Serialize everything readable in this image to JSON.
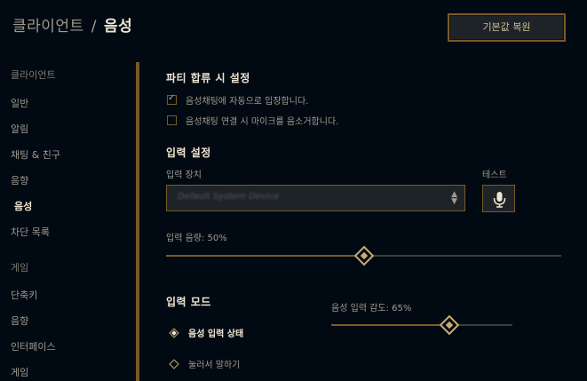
{
  "header": {
    "section": "클라이언트",
    "separator": "/",
    "current": "음성",
    "reset_label": "기본값 복원"
  },
  "sidebar": {
    "client_section": "클라이언트",
    "client_items": [
      {
        "label": "일반"
      },
      {
        "label": "알림"
      },
      {
        "label": "채팅 & 친구"
      },
      {
        "label": "음향"
      },
      {
        "label": "음성",
        "active": true
      },
      {
        "label": "차단 목록"
      }
    ],
    "game_section": "게임",
    "game_items": [
      {
        "label": "단축키"
      },
      {
        "label": "음향"
      },
      {
        "label": "인터페이스"
      },
      {
        "label": "게임"
      }
    ]
  },
  "party": {
    "title": "파티 합류 시 설정",
    "options": [
      {
        "label": "음성채팅에 자동으로 입장합니다.",
        "checked": true
      },
      {
        "label": "음성채팅 연결 시 마이크를 음소거합니다.",
        "checked": false
      }
    ]
  },
  "input": {
    "title": "입력 설정",
    "device_label": "입력 장치",
    "device_value": "Default System Device",
    "test_label": "테스트",
    "volume_label": "입력 음량: 50%",
    "volume": 0.5
  },
  "mode": {
    "title": "입력 모드",
    "options": [
      {
        "label": "음성 입력 상태",
        "selected": true
      },
      {
        "label": "눌러서 말하기",
        "selected": false
      }
    ],
    "sensitivity_label": "음성 입력 감도: 65%",
    "sensitivity": 0.65
  },
  "colors": {
    "gold": "#c8aa6e",
    "gold_dark": "#785a28",
    "background": "#010a13",
    "text_light": "#f0e6d2"
  },
  "icons": {
    "test": "microphone-icon",
    "check": "checkmark-icon",
    "select": "up-down-arrows-icon"
  }
}
